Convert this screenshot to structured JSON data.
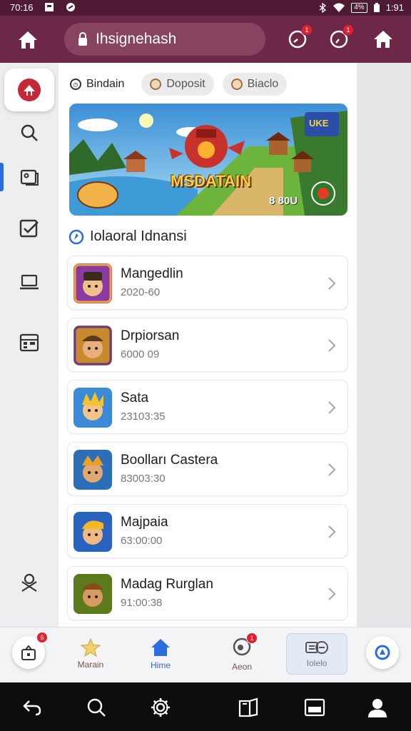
{
  "status_bar": {
    "time_left": "70:16",
    "time_right": "1:91",
    "battery": "4%"
  },
  "app_bar": {
    "url": "Ihsignehash",
    "notification_badge_1": "1",
    "notification_badge_2": "1"
  },
  "chips": [
    {
      "label": "Bindain",
      "icon": "clock-icon"
    },
    {
      "label": "Doposit",
      "icon": "coin-icon"
    },
    {
      "label": "Biaclo",
      "icon": "coin-icon"
    }
  ],
  "banner": {
    "title": "MSDATAIN",
    "score": "8 80U",
    "corner_tag": "UKE",
    "colors": {
      "sky": "#4fa0dc",
      "grass": "#5aa43a",
      "accent": "#f8d23a"
    }
  },
  "section": {
    "title": "Iolaoral Idnansi"
  },
  "list": [
    {
      "name": "Mangedlin",
      "sub": "2020-60",
      "thumb_bg": "#8a3aa0"
    },
    {
      "name": "Drpiorsan",
      "sub": "6000 09",
      "thumb_bg": "#c78a2c"
    },
    {
      "name": "Sata",
      "sub": "23103:35",
      "thumb_bg": "#3a8ad8"
    },
    {
      "name": "Boolları Castera",
      "sub": "83003:30",
      "thumb_bg": "#2c6fb8"
    },
    {
      "name": "Majpaia",
      "sub": "63:00:00",
      "thumb_bg": "#2a62c0"
    },
    {
      "name": "Madag Rurglan",
      "sub": "91:00:38",
      "thumb_bg": "#5c7a1c"
    }
  ],
  "bottom_nav": {
    "left_badge": "6",
    "tabs": [
      {
        "label": "Marain",
        "icon": "star-icon"
      },
      {
        "label": "Hime",
        "icon": "home-icon"
      },
      {
        "label": "Aeon",
        "icon": "target-icon",
        "badge": "1"
      },
      {
        "label": "Iolelo",
        "icon": "toggle-icon"
      }
    ]
  },
  "colors": {
    "app_bar": "#6d2747",
    "accent_blue": "#2b6de0",
    "badge_red": "#e0202e"
  }
}
